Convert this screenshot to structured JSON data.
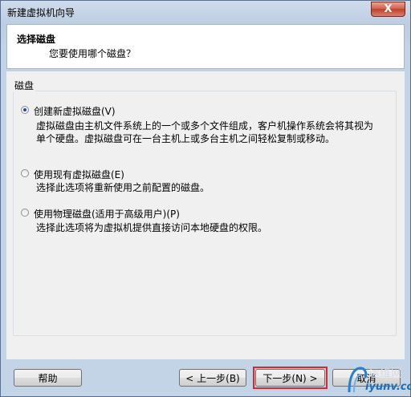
{
  "window": {
    "title": "新建虚拟机向导",
    "close_glyph": "X"
  },
  "header": {
    "title": "选择磁盘",
    "subtitle": "您要使用哪个磁盘？"
  },
  "group": {
    "label": "磁盘",
    "options": [
      {
        "label": "创建新虚拟磁盘(V)",
        "selected": true,
        "description": "虚拟磁盘由主机文件系统上的一个或多个文件组成，客户机操作系统会将其视为单个硬盘。虚拟磁盘可在一台主机上或多台主机之间轻松复制或移动。"
      },
      {
        "label": "使用现有虚拟磁盘(E)",
        "selected": false,
        "description": "选择此选项将重新使用之前配置的磁盘。"
      },
      {
        "label": "使用物理磁盘(适用于高级用户)(P)",
        "selected": false,
        "description": "选择此选项将为虚拟机提供直接访问本地硬盘的权限。"
      }
    ]
  },
  "buttons": {
    "help": "帮助",
    "back": "< 上一步(B)",
    "next": "下一步(N) >",
    "cancel": "取消"
  },
  "watermark": {
    "text_cn": "运维网",
    "text_url": "iyunv.com"
  },
  "colors": {
    "highlight": "#e0262c",
    "radio_dot": "#1f4c9e"
  }
}
